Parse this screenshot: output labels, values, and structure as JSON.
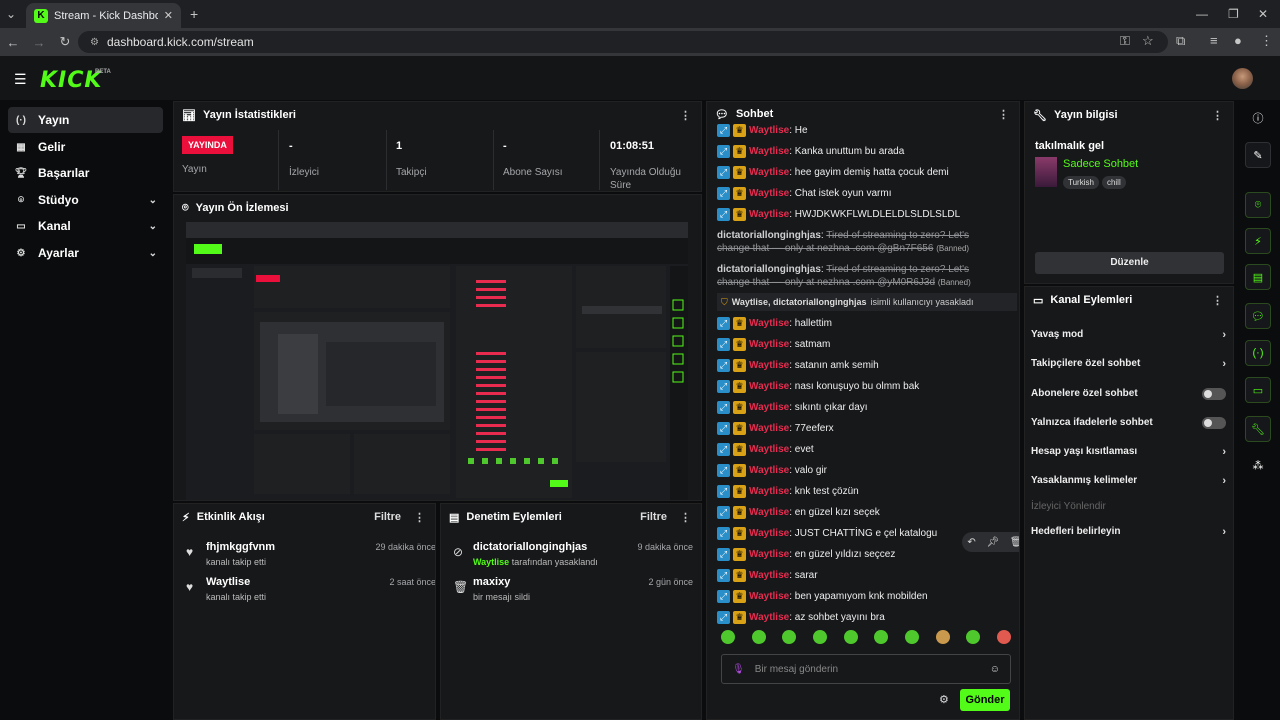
{
  "browser": {
    "tab_title": "Stream - Kick Dashboard",
    "url": "dashboard.kick.com/stream"
  },
  "header": {
    "logo": "KICK",
    "beta": "BETA"
  },
  "sidebar": {
    "items": [
      {
        "label": "Yayın",
        "icon": "broadcast-icon"
      },
      {
        "label": "Gelir",
        "icon": "revenue-icon"
      },
      {
        "label": "Başarılar",
        "icon": "trophy-icon"
      },
      {
        "label": "Stüdyo",
        "icon": "studio-icon"
      },
      {
        "label": "Kanal",
        "icon": "channel-icon"
      },
      {
        "label": "Ayarlar",
        "icon": "settings-icon"
      }
    ]
  },
  "stats": {
    "title": "Yayın İstatistikleri",
    "live_badge": "YAYINDA",
    "live_label": "Yayın",
    "viewers_value": "-",
    "viewers_label": "İzleyici",
    "followers_value": "1",
    "followers_label": "Takipçi",
    "subs_value": "-",
    "subs_label": "Abone Sayısı",
    "duration_value": "01:08:51",
    "duration_label": "Yayında Olduğu Süre"
  },
  "preview": {
    "title": "Yayın Ön İzlemesi"
  },
  "activity": {
    "title": "Etkinlik Akışı",
    "filter": "Filtre",
    "items": [
      {
        "name": "fhjmkggfvnm",
        "sub": "kanalı takip etti",
        "time": "29 dakika önce"
      },
      {
        "name": "Waytlise",
        "sub": "kanalı takip etti",
        "time": "2 saat önce"
      }
    ]
  },
  "moderation": {
    "title": "Denetim Eylemleri",
    "filter": "Filtre",
    "items": [
      {
        "name": "dictatoriallonginghjas",
        "actor": "Waytlise",
        "sub": "tarafından yasaklandı",
        "time": "9 dakika önce"
      },
      {
        "name": "maxixy",
        "sub": "bir mesajı sildi",
        "time": "2 gün önce"
      }
    ]
  },
  "chat": {
    "title": "Sohbet",
    "user": "Waytlise",
    "messages": [
      {
        "text": "He"
      },
      {
        "text": "Kanka unuttum bu arada"
      },
      {
        "text": "hee gayim demiş hatta çocuk demi"
      },
      {
        "text": "Chat istek oyun varmı"
      },
      {
        "text": "HWJDKWKFLWLDLELDLSLDLSLDL"
      }
    ],
    "banned": [
      {
        "user": "dictatoriallonginghjas",
        "text": "Tired of streaming to zero? Let's change that — only at nezhna .com @gBn7F656",
        "tag": "(Banned)"
      },
      {
        "user": "dictatoriallonginghjas",
        "text": "Tired of streaming to zero? Let's change that — only at nezhna .com @yM0R6J3d",
        "tag": "(Banned)"
      }
    ],
    "system": {
      "users": "Waytlise, dictatoriallonginghjas",
      "text": "isimli kullanıcıyı yasakladı"
    },
    "messages2": [
      {
        "text": "hallettim"
      },
      {
        "text": "satmam"
      },
      {
        "text": "satanın amk semih"
      },
      {
        "text": "nası konuşuyo bu olmm bak"
      },
      {
        "text": "sıkıntı çıkar dayı"
      },
      {
        "text": "77eeferx"
      },
      {
        "text": "evet"
      },
      {
        "text": "valo gir"
      },
      {
        "text": "knk test çözün"
      },
      {
        "text": "en güzel kızı seçek"
      },
      {
        "text": "JUST CHATTİNG e çel katalogu"
      },
      {
        "text": "en güzel yıldızı seçcez"
      },
      {
        "text": "sarar"
      },
      {
        "text": "ben yapamıyom knk mobilden"
      },
      {
        "text": "az sohbet yayını bra"
      }
    ],
    "input_placeholder": "Bir mesaj gönderin",
    "send_label": "Gönder"
  },
  "stream_info": {
    "title": "Yayın bilgisi",
    "stream_title": "takılmalık gel",
    "category": "Sadece Sohbet",
    "tags": [
      "Turkish",
      "chill"
    ],
    "edit_label": "Düzenle"
  },
  "channel_actions": {
    "title": "Kanal Eylemleri",
    "items": [
      {
        "label": "Yavaş mod",
        "control": "chevron"
      },
      {
        "label": "Takipçilere özel sohbet",
        "control": "chevron"
      },
      {
        "label": "Abonelere özel sohbet",
        "control": "toggle"
      },
      {
        "label": "Yalnızca ifadelerle sohbet",
        "control": "toggle"
      },
      {
        "label": "Hesap yaşı kısıtlaması",
        "control": "chevron"
      },
      {
        "label": "Yasaklanmış kelimeler",
        "control": "chevron"
      },
      {
        "label": "İzleyici Yönlendir",
        "control": "none"
      },
      {
        "label": "Hedefleri belirleyin",
        "control": "chevron"
      }
    ]
  },
  "colors": {
    "brand": "#53fc18",
    "live": "#eb0f3c",
    "username": "#e82b4f"
  }
}
